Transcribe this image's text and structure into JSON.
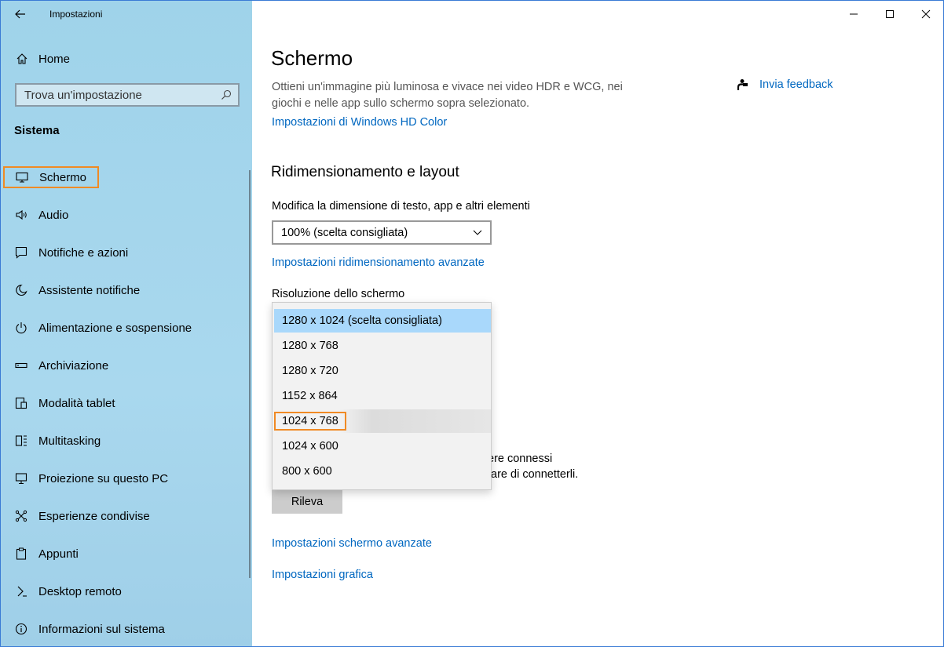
{
  "window": {
    "title": "Impostazioni"
  },
  "sidebar": {
    "home": "Home",
    "search_placeholder": "Trova un'impostazione",
    "section": "Sistema",
    "items": [
      {
        "label": "Schermo",
        "icon": "monitor-icon"
      },
      {
        "label": "Audio",
        "icon": "speaker-icon"
      },
      {
        "label": "Notifiche e azioni",
        "icon": "notification-icon"
      },
      {
        "label": "Assistente notifiche",
        "icon": "moon-icon"
      },
      {
        "label": "Alimentazione e sospensione",
        "icon": "power-icon"
      },
      {
        "label": "Archiviazione",
        "icon": "storage-icon"
      },
      {
        "label": "Modalità tablet",
        "icon": "tablet-icon"
      },
      {
        "label": "Multitasking",
        "icon": "multitasking-icon"
      },
      {
        "label": "Proiezione su questo PC",
        "icon": "projection-icon"
      },
      {
        "label": "Esperienze condivise",
        "icon": "shared-icon"
      },
      {
        "label": "Appunti",
        "icon": "clipboard-icon"
      },
      {
        "label": "Desktop remoto",
        "icon": "remote-icon"
      },
      {
        "label": "Informazioni sul sistema",
        "icon": "info-icon"
      }
    ]
  },
  "main": {
    "title": "Schermo",
    "hdr_description": "Ottieni un'immagine più luminosa e vivace nei video HDR e WCG, nei giochi e nelle app sullo schermo sopra selezionato.",
    "hdr_link": "Impostazioni di Windows HD Color",
    "feedback": "Invia feedback",
    "scaling_heading": "Ridimensionamento e layout",
    "scaling_label": "Modifica la dimensione di testo, app e altri elementi",
    "scaling_value": "100% (scelta consigliata)",
    "scaling_advanced": "Impostazioni ridimensionamento avanzate",
    "resolution_label": "Risoluzione dello schermo",
    "resolution_options": [
      "1280 x 1024 (scelta consigliata)",
      "1280 x 768",
      "1280 x 720",
      "1152 x 864",
      "1024 x 768",
      "1024 x 600",
      "800 x 600"
    ],
    "partial_line1": "ere connessi",
    "partial_line2": "tare di connetterli.",
    "detect_button": "Rileva",
    "advanced_display": "Impostazioni schermo avanzate",
    "graphics": "Impostazioni grafica"
  },
  "colors": {
    "accent": "#0067c0",
    "highlight": "#f08a24",
    "sidebar": "#a9d8ee",
    "selected_option": "#a9d8fb"
  }
}
